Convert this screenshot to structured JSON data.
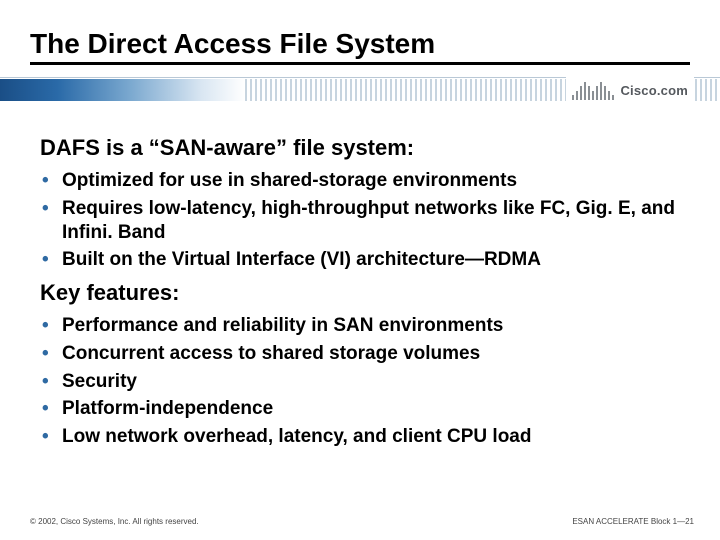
{
  "title": "The Direct Access File System",
  "logo_text": "Cisco.com",
  "section1": {
    "heading": "DAFS is a “SAN-aware” file system:",
    "bullets": [
      "Optimized for use in shared-storage environments",
      "Requires low-latency, high-throughput networks like FC, Gig. E, and Infini. Band",
      "Built on the Virtual Interface (VI) architecture—RDMA"
    ]
  },
  "section2": {
    "heading": "Key features:",
    "bullets": [
      "Performance and reliability in SAN environments",
      "Concurrent access to shared storage volumes",
      "Security",
      "Platform-independence",
      "Low network overhead, latency, and client CPU load"
    ]
  },
  "footer": {
    "copyright": "© 2002, Cisco Systems, Inc. All rights reserved.",
    "slide_ref": "ESAN ACCELERATE Block 1—21"
  }
}
